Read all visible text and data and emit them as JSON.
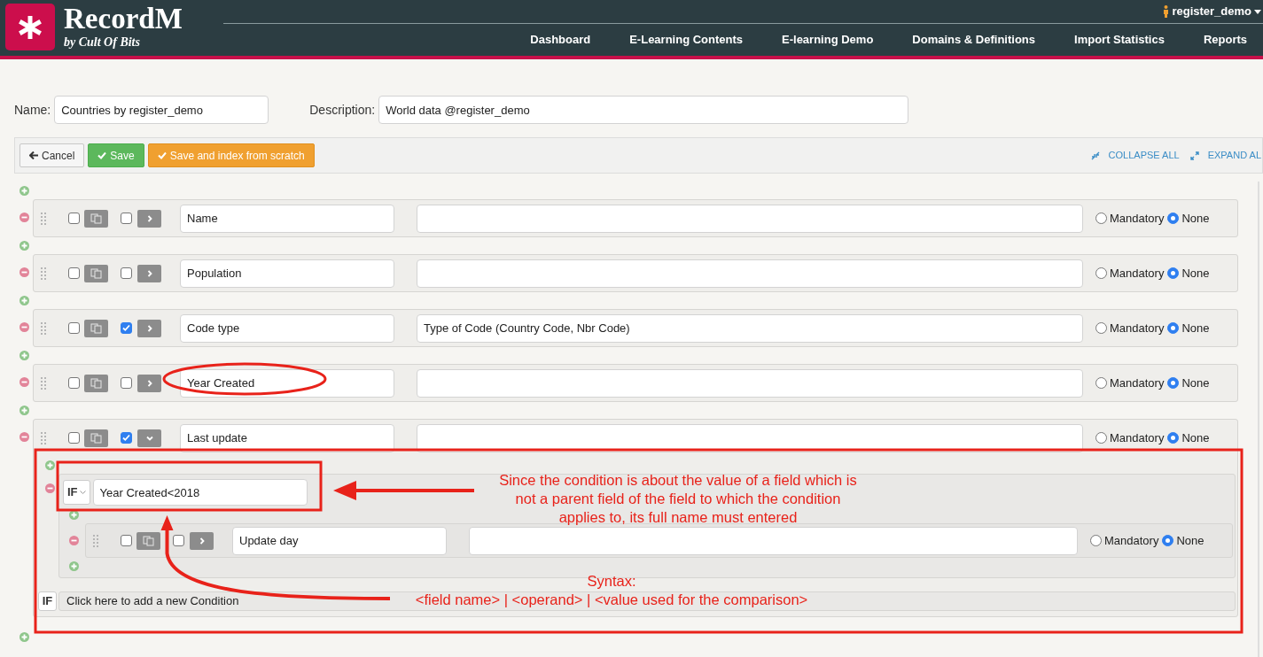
{
  "app": {
    "title": "RecordM",
    "subtitle": "by Cult Of Bits"
  },
  "user": {
    "name": "register_demo"
  },
  "nav": [
    {
      "label": "Dashboard"
    },
    {
      "label": "E-Learning Contents"
    },
    {
      "label": "E-learning Demo"
    },
    {
      "label": "Domains & Definitions"
    },
    {
      "label": "Import Statistics"
    },
    {
      "label": "Reports"
    }
  ],
  "form": {
    "name_label": "Name:",
    "name_value": "Countries by register_demo",
    "description_label": "Description:",
    "description_value": "World data @register_demo"
  },
  "toolbar": {
    "buttons": [
      {
        "label": "Cancel",
        "kind": "back"
      },
      {
        "label": "Save",
        "kind": "save"
      },
      {
        "label": "Save and index from scratch",
        "kind": "reindex"
      }
    ],
    "links": [
      {
        "label": "COLLAPSE ALL",
        "kind": "collapse"
      },
      {
        "label": "EXPAND AL",
        "kind": "expand"
      }
    ]
  },
  "fields": [
    {
      "name": "Name",
      "checkboxes": [
        {
          "checked": false
        },
        {
          "checked": false
        }
      ],
      "expanded": false,
      "options": [
        {
          "label": "Mandatory",
          "selected": false
        },
        {
          "label": "None",
          "selected": true
        }
      ]
    },
    {
      "name": "Population",
      "checkboxes": [
        {
          "checked": false
        },
        {
          "checked": false
        }
      ],
      "expanded": false,
      "options": [
        {
          "label": "Mandatory",
          "selected": false
        },
        {
          "label": "None",
          "selected": true
        }
      ]
    },
    {
      "name": "Code type",
      "description": "Type of Code (Country Code, Nbr Code)",
      "checkboxes": [
        {
          "checked": false
        },
        {
          "checked": true
        }
      ],
      "expanded": false,
      "options": [
        {
          "label": "Mandatory",
          "selected": false
        },
        {
          "label": "None",
          "selected": true
        }
      ]
    },
    {
      "name": "Year Created",
      "checkboxes": [
        {
          "checked": false
        },
        {
          "checked": false
        }
      ],
      "expanded": false,
      "options": [
        {
          "label": "Mandatory",
          "selected": false
        },
        {
          "label": "None",
          "selected": true
        }
      ]
    },
    {
      "name": "Last update",
      "checkboxes": [
        {
          "checked": false
        },
        {
          "checked": true
        }
      ],
      "expanded": true,
      "options": [
        {
          "label": "Mandatory",
          "selected": false
        },
        {
          "label": "None",
          "selected": true
        }
      ],
      "conditions": [
        {
          "operator": "IF",
          "expression": "Year Created<2018",
          "fields": [
            {
              "name": "Update day",
              "checkboxes": [
                {
                  "checked": false
                },
                {
                  "checked": false
                }
              ],
              "expanded": false,
              "options": [
                {
                  "label": "Mandatory",
                  "selected": false
                },
                {
                  "label": "None",
                  "selected": true
                }
              ]
            }
          ]
        }
      ],
      "add_condition": {
        "operator": "IF",
        "label": "Click here to add a new Condition"
      }
    }
  ],
  "annotations": [
    {
      "kind": "callout",
      "lines": [
        "Since the condition is about the value of a field which is",
        "not a parent field of the field to which the condition",
        "applies to, its full name must entered"
      ]
    },
    {
      "kind": "syntax",
      "lines": [
        "Syntax:",
        "<field name> | <operand> | <value used for the comparison>"
      ]
    }
  ]
}
